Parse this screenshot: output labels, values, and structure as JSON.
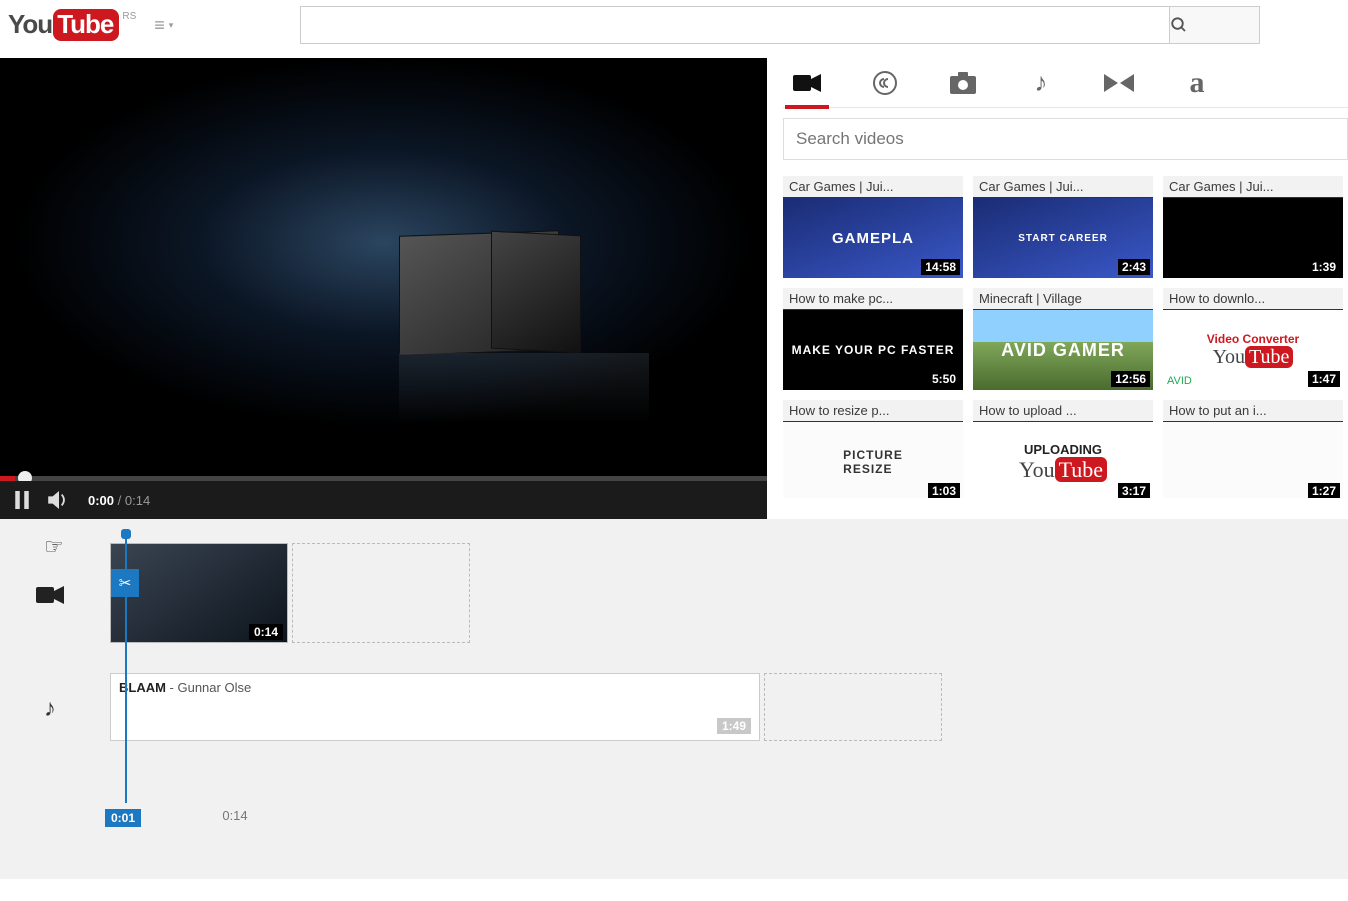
{
  "header": {
    "logo_you": "You",
    "logo_tube": "Tube",
    "region": "RS",
    "search_placeholder": ""
  },
  "player": {
    "current_time": "0:00",
    "duration": "0:14"
  },
  "tabs": {
    "active": "video"
  },
  "video_search": {
    "placeholder": "Search videos"
  },
  "videos": [
    {
      "title": "Car Games | Jui...",
      "duration": "14:58",
      "style": "juiced1",
      "art": "GAMEPLA"
    },
    {
      "title": "Car Games | Jui...",
      "duration": "2:43",
      "style": "juiced2",
      "art": "START CAREER"
    },
    {
      "title": "Car Games | Jui...",
      "duration": "1:39",
      "style": "track",
      "art": ""
    },
    {
      "title": "How to make pc...",
      "duration": "5:50",
      "style": "pcfast",
      "art": "MAKE YOUR PC FASTER"
    },
    {
      "title": "Minecraft | Village",
      "duration": "12:56",
      "style": "mc",
      "art": "AVID GAMER"
    },
    {
      "title": "How to downlo...",
      "duration": "1:47",
      "style": "ytconv",
      "art": "Video Converter",
      "sub": "AVID"
    },
    {
      "title": "How to resize p...",
      "duration": "1:03",
      "style": "resize",
      "art": "PICTURE RESIZE"
    },
    {
      "title": "How to upload ...",
      "duration": "3:17",
      "style": "upload",
      "art": "UPLOADING"
    },
    {
      "title": "How to put an i...",
      "duration": "1:27",
      "style": "putimg",
      "art": ""
    }
  ],
  "timeline": {
    "video_clip_duration": "0:14",
    "audio_clip_title_bold": "BLAAM",
    "audio_clip_title_rest": " - Gunnar Olse",
    "audio_clip_duration": "1:49",
    "playhead_time": "0:01",
    "ruler_mark": "0:14"
  }
}
